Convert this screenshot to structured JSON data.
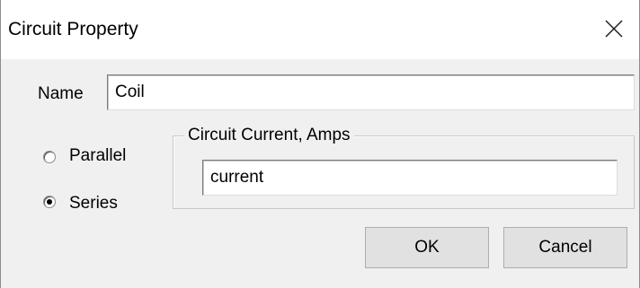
{
  "dialog": {
    "title": "Circuit Property",
    "close_icon": "close-icon"
  },
  "name_field": {
    "label": "Name",
    "value": "Coil"
  },
  "connection_type": {
    "options": [
      {
        "label": "Parallel",
        "selected": false
      },
      {
        "label": "Series",
        "selected": true
      }
    ]
  },
  "circuit_current": {
    "group_label": "Circuit Current, Amps",
    "value": "current"
  },
  "buttons": {
    "ok_label": "OK",
    "cancel_label": "Cancel"
  }
}
